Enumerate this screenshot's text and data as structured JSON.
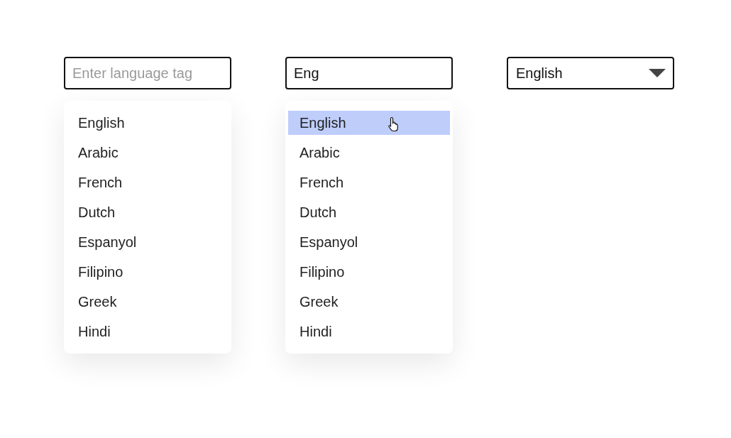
{
  "combos": [
    {
      "kind": "search",
      "placeholder": "Enter language tag",
      "options": [
        {
          "label": "English",
          "selected": false
        },
        {
          "label": "Arabic",
          "selected": false
        },
        {
          "label": "French",
          "selected": false
        },
        {
          "label": "Dutch",
          "selected": false
        },
        {
          "label": "Espanyol",
          "selected": false
        },
        {
          "label": "Filipino",
          "selected": false
        },
        {
          "label": "Greek",
          "selected": false
        },
        {
          "label": "Hindi",
          "selected": false
        }
      ]
    },
    {
      "kind": "search",
      "value": "Eng",
      "options": [
        {
          "label": "English",
          "selected": true
        },
        {
          "label": "Arabic",
          "selected": false
        },
        {
          "label": "French",
          "selected": false
        },
        {
          "label": "Dutch",
          "selected": false
        },
        {
          "label": "Espanyol",
          "selected": false
        },
        {
          "label": "Filipino",
          "selected": false
        },
        {
          "label": "Greek",
          "selected": false
        },
        {
          "label": "Hindi",
          "selected": false
        }
      ]
    },
    {
      "kind": "select",
      "value": "English"
    }
  ]
}
